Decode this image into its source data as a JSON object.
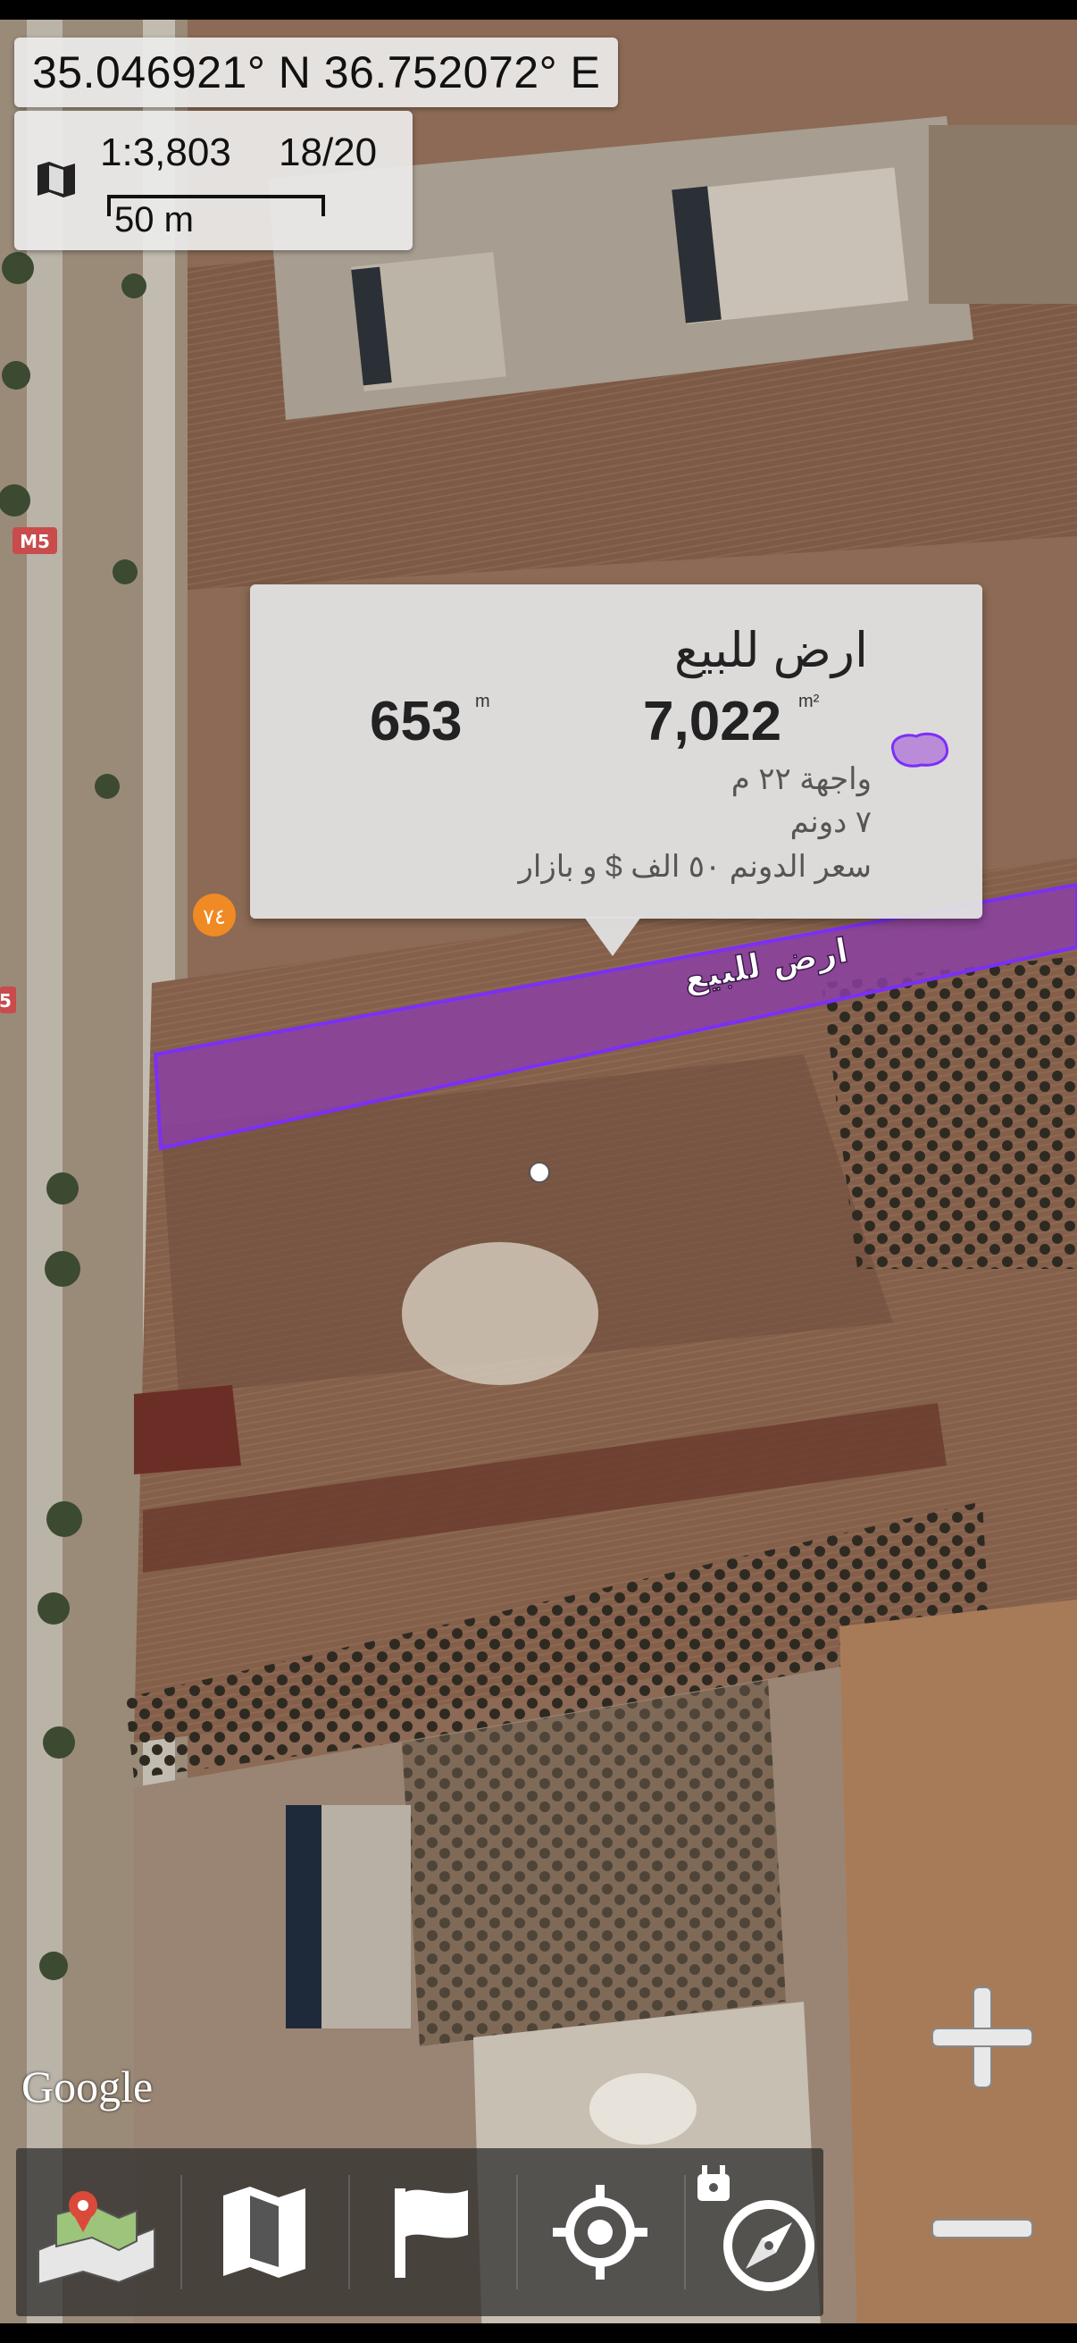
{
  "location": {
    "coordinates": "35.046921° N 36.752072° E"
  },
  "scale": {
    "ratio": "1:3,803",
    "zoom": "18/20",
    "distance": "50 m"
  },
  "parcel": {
    "map_label": "ارض للبيع",
    "title": "ارض للبيع",
    "area_value": "7,022",
    "area_unit": "m²",
    "perimeter_value": "653",
    "perimeter_unit": "m",
    "frontage": "واجهة ٢٢ م",
    "size": "٧ دونم",
    "price": "سعر الدونم ٥٠ الف $ و بازار",
    "fill_color": "#8b3fa6",
    "stroke_color": "#7b2ff7"
  },
  "road_labels": {
    "highway": "M5",
    "highway_partial": "5",
    "poi": "٧٤"
  },
  "attribution": "Google",
  "toolbar": {
    "items": [
      "layers-map-icon",
      "map-icon",
      "flag-icon",
      "my-location-icon",
      "compass-icon"
    ]
  },
  "zoom_controls": [
    "zoom-in-icon",
    "zoom-out-icon"
  ]
}
